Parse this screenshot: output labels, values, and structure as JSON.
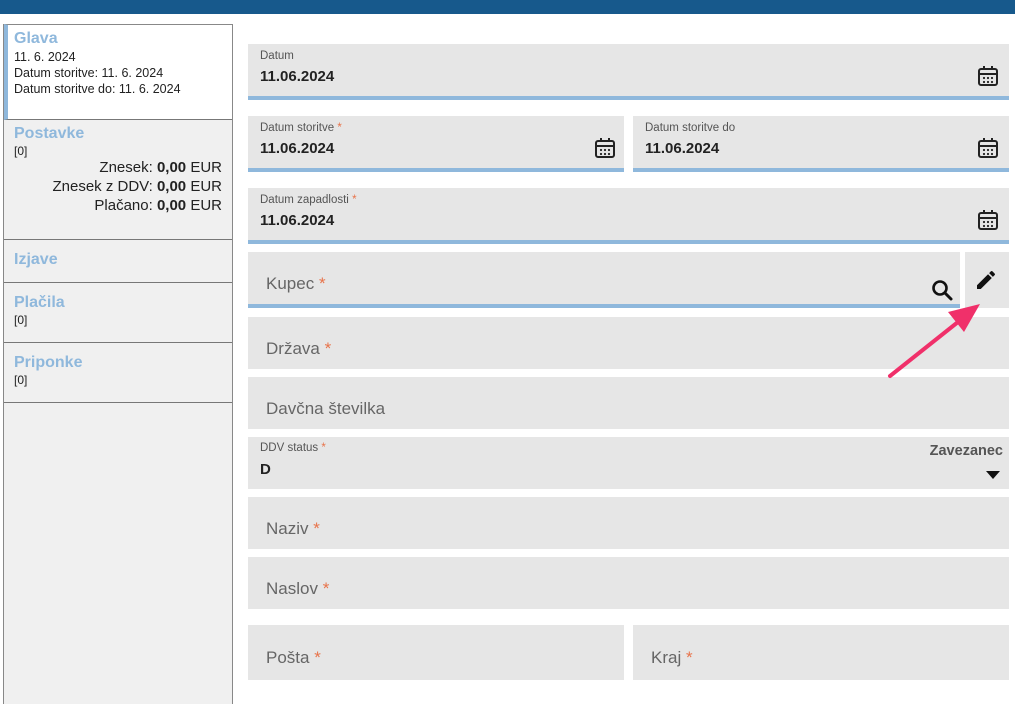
{
  "sidebar": {
    "glava": {
      "title": "Glava",
      "line1": "11. 6. 2024",
      "line2": "Datum storitve: 11. 6. 2024",
      "line3": "Datum storitve do: 11. 6. 2024"
    },
    "postavke": {
      "title": "Postavke",
      "count": "[0]",
      "znesek_label": "Znesek:",
      "znesek_value": "0,00",
      "znesek_cur": "EUR",
      "znesek_ddv_label": "Znesek z DDV:",
      "znesek_ddv_value": "0,00",
      "znesek_ddv_cur": "EUR",
      "placano_label": "Plačano:",
      "placano_value": "0,00",
      "placano_cur": "EUR"
    },
    "izjave": {
      "title": "Izjave"
    },
    "placila": {
      "title": "Plačila",
      "count": "[0]"
    },
    "priponke": {
      "title": "Priponke",
      "count": "[0]"
    }
  },
  "form": {
    "datum": {
      "label": "Datum",
      "value": "11.06.2024"
    },
    "datum_storitve": {
      "label": "Datum storitve",
      "req": "*",
      "value": "11.06.2024"
    },
    "datum_storitve_do": {
      "label": "Datum storitve do",
      "value": "11.06.2024"
    },
    "datum_zapadlosti": {
      "label": "Datum zapadlosti",
      "req": "*",
      "value": "11.06.2024"
    },
    "kupec": {
      "placeholder": "Kupec",
      "req": "*"
    },
    "drzava": {
      "placeholder": "Država",
      "req": "*"
    },
    "davcna": {
      "placeholder": "Davčna številka"
    },
    "ddv_status": {
      "label": "DDV status",
      "req": "*",
      "value": "D",
      "option": "Zavezanec"
    },
    "naziv": {
      "placeholder": "Naziv",
      "req": "*"
    },
    "naslov": {
      "placeholder": "Naslov",
      "req": "*"
    },
    "posta": {
      "placeholder": "Pošta",
      "req": "*"
    },
    "kraj": {
      "placeholder": "Kraj",
      "req": "*"
    }
  },
  "icons": {
    "calendar": "calendar-icon",
    "search": "search-icon",
    "edit": "pencil-icon",
    "dropdown": "caret-down-icon"
  },
  "colors": {
    "topbar": "#17598c",
    "accent": "#8fb8dc",
    "required": "#e8734a",
    "arrow": "#f0306a"
  }
}
